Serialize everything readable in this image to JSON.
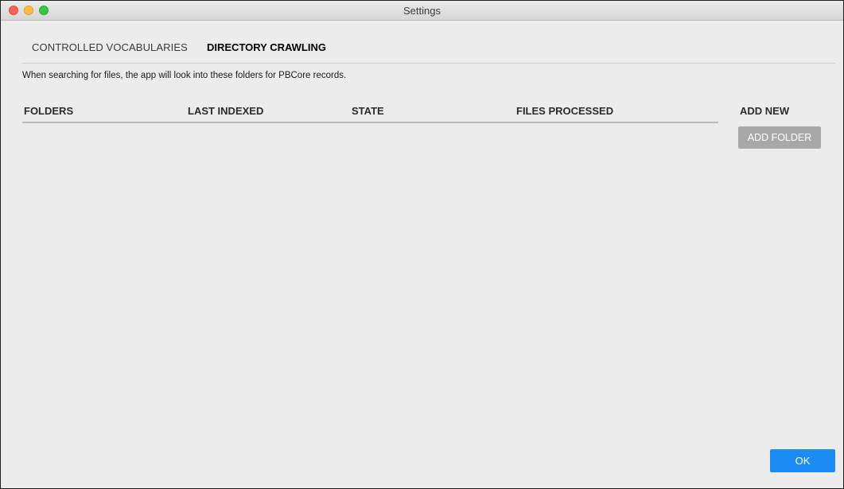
{
  "window": {
    "title": "Settings"
  },
  "tabs": [
    {
      "label": "CONTROLLED VOCABULARIES",
      "active": false
    },
    {
      "label": "DIRECTORY CRAWLING",
      "active": true
    }
  ],
  "description": "When searching for files, the app will look into these folders for PBCore records.",
  "table": {
    "columns": [
      "FOLDERS",
      "LAST INDEXED",
      "STATE",
      "FILES PROCESSED"
    ],
    "rows": []
  },
  "add_new": {
    "label": "ADD NEW",
    "button_label": "ADD FOLDER"
  },
  "footer": {
    "ok_label": "OK"
  },
  "colors": {
    "ok_button": "#1b8cf4",
    "add_folder_button": "#a8a8a8",
    "close": "#fc605c",
    "minimize": "#fdbc40",
    "zoom": "#34c84a"
  }
}
